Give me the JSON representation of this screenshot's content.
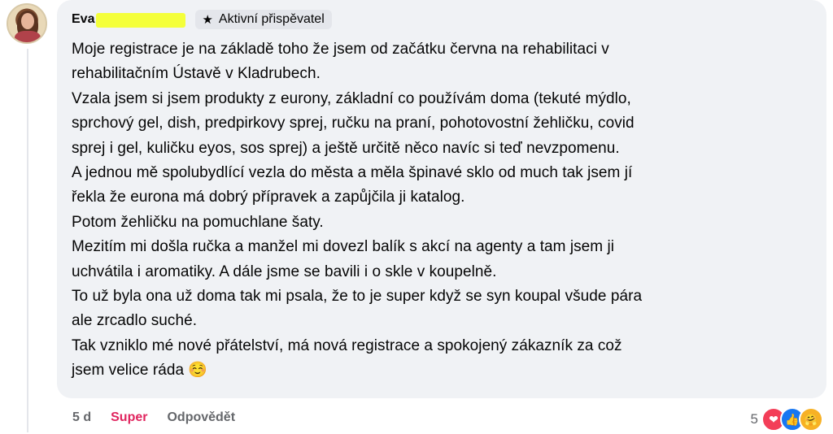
{
  "comment": {
    "author_name": "Eva",
    "badge_label": "Aktivní přispěvatel",
    "lines": [
      "Moje registrace je na základě toho že jsem od začátku června na rehabilitaci v",
      "rehabilitačním Ústavě v Kladrubech.",
      "Vzala jsem si jsem produkty z eurony, základní co používám doma (tekuté mýdlo,",
      "sprchový gel, dish, predpirkovy sprej, ručku na praní, pohotovostní žehličku, covid",
      "sprej i gel, kuličku eyos, sos sprej) a ještě určitě něco navíc si teď nevzpomenu.",
      "A jednou mě spolubydlící vezla do města a měla špinavé sklo od much tak jsem jí",
      "řekla že eurona má dobrý přípravek a zapůjčila ji katalog.",
      "Potom žehličku na pomuchlane šaty.",
      "Mezitím mi došla ručka a manžel mi dovezl balík s akcí na agenty a tam jsem ji",
      "uchvátila i aromatiky. A dále jsme se bavili i o skle v koupelně.",
      "To už byla ona už doma tak mi psala, že to je super když se syn koupal všude pára",
      "ale zrcadlo suché.",
      "Tak vzniklo mé nové přátelství, má nová registrace a spokojený zákazník za což",
      "jsem velice ráda ☺️"
    ]
  },
  "meta": {
    "time": "5 d",
    "reaction_label": "Super",
    "reply_label": "Odpovědět"
  },
  "reactions": {
    "count": "5",
    "icons": [
      "heart-icon",
      "like-icon",
      "care-icon"
    ],
    "colors": {
      "love": "#f33e58",
      "like": "#1877f2",
      "care": "#f7b125"
    }
  },
  "colors": {
    "bubble": "#f0f2f5",
    "text": "#050505",
    "muted": "#65676b",
    "super": "#e0245e",
    "redaction": "#f4ff3a"
  }
}
